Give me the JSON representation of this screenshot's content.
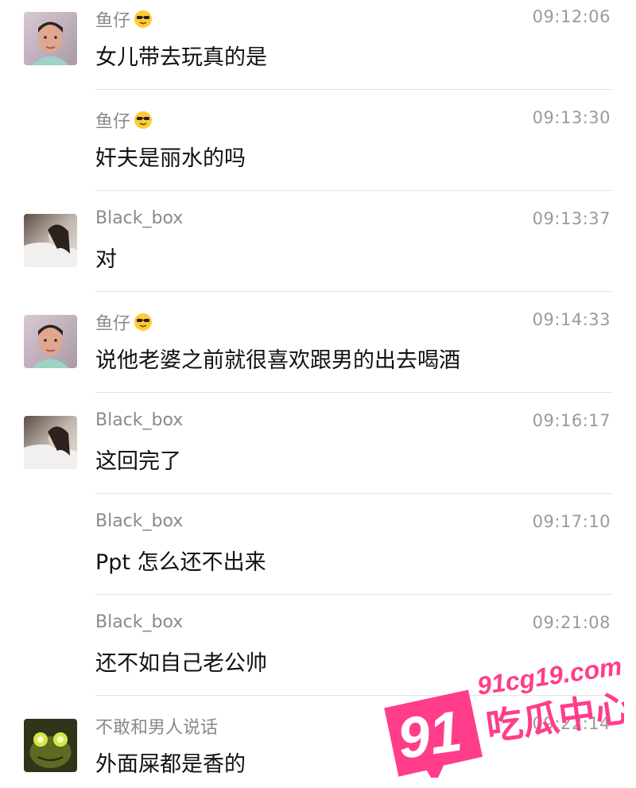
{
  "messages": [
    {
      "sender": "鱼仔",
      "emoji": "sunglasses-emoji",
      "time": "09:12:06",
      "text": "女儿带去玩真的是",
      "avatar": "boy-avatar"
    },
    {
      "sender": "鱼仔",
      "emoji": "sunglasses-emoji",
      "time": "09:13:30",
      "text": "奸夫是丽水的吗",
      "avatar": ""
    },
    {
      "sender": "Black_box",
      "emoji": "",
      "time": "09:13:37",
      "text": "对",
      "avatar": "girl-avatar"
    },
    {
      "sender": "鱼仔",
      "emoji": "sunglasses-emoji",
      "time": "09:14:33",
      "text": "说他老婆之前就很喜欢跟男的出去喝酒",
      "avatar": "boy-avatar"
    },
    {
      "sender": "Black_box",
      "emoji": "",
      "time": "09:16:17",
      "text": "这回完了",
      "avatar": "girl-avatar"
    },
    {
      "sender": "Black_box",
      "emoji": "",
      "time": "09:17:10",
      "text": "Ppt 怎么还不出来",
      "avatar": ""
    },
    {
      "sender": "Black_box",
      "emoji": "",
      "time": "09:21:08",
      "text": "还不如自己老公帅",
      "avatar": ""
    },
    {
      "sender": "不敢和男人说话",
      "emoji": "",
      "time": "09:22:14",
      "text": "外面屎都是香的",
      "avatar": "frog-avatar"
    }
  ],
  "watermark": {
    "number": "91",
    "site": "91cg19.com",
    "name": "吃瓜中心",
    "color": "#ff3d8b"
  }
}
